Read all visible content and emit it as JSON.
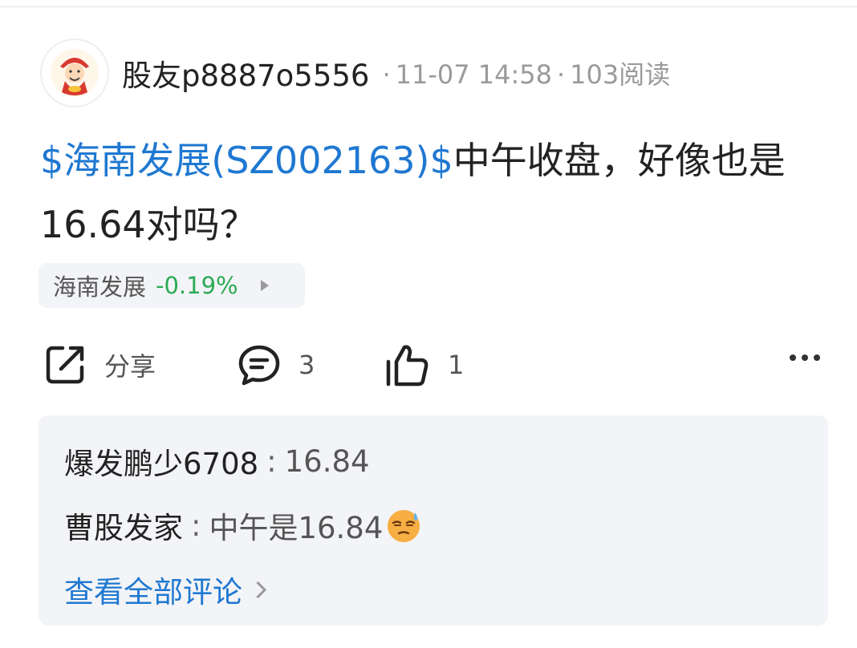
{
  "post": {
    "author": "股友p8887o5556",
    "time": "11-07 14:58",
    "reads": "103阅读",
    "stock_tag": "$海南发展(SZ002163)$",
    "content": "中午收盘，好像也是16.64对吗？"
  },
  "stock_chip": {
    "name": "海南发展",
    "change": "-0.19%"
  },
  "actions": {
    "share_label": "分享",
    "comment_count": "3",
    "like_count": "1"
  },
  "comments": [
    {
      "author": "爆发鹏少6708",
      "text": "16.84"
    },
    {
      "author": "曹股发家",
      "text": "中午是16.84"
    }
  ],
  "view_all": "查看全部评论",
  "colors": {
    "link": "#1f78d1",
    "down_green": "#2bab55",
    "panel_bg": "#f3f4f7"
  }
}
